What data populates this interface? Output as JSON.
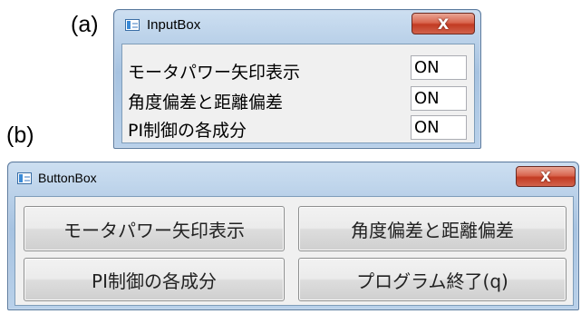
{
  "labels": {
    "a": "(a)",
    "b": "(b)"
  },
  "input_box": {
    "title": "InputBox",
    "close_glyph": "X",
    "rows": [
      {
        "label": "モータパワー矢印表示",
        "value": "ON"
      },
      {
        "label": "角度偏差と距離偏差",
        "value": "ON"
      },
      {
        "label": "PI制御の各成分",
        "value": "ON"
      }
    ]
  },
  "button_box": {
    "title": "ButtonBox",
    "close_glyph": "X",
    "buttons": [
      {
        "label": "モータパワー矢印表示"
      },
      {
        "label": "角度偏差と距離偏差"
      },
      {
        "label": "PI制御の各成分"
      },
      {
        "label": "プログラム終了(q)"
      }
    ]
  },
  "colors": {
    "close_button": "#c94a33",
    "titlebar": "#b9d1ea",
    "client": "#f0f0f0"
  },
  "icons": {
    "app": "window-app-icon",
    "close": "close-icon"
  }
}
